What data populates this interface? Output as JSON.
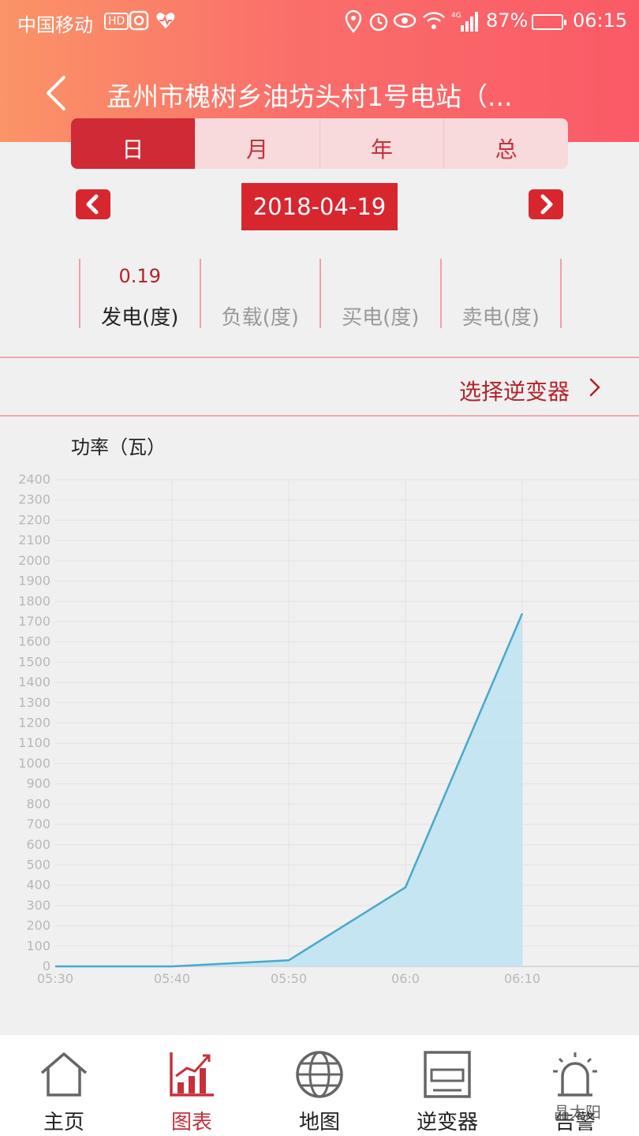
{
  "status_bar": {
    "carrier": "中国移动",
    "hd": "HD",
    "battery_percent": "87%",
    "time": "06:15"
  },
  "header": {
    "title": "孟州市槐树乡油坊头村1号电站（..."
  },
  "tabs": [
    {
      "label": "日",
      "active": true
    },
    {
      "label": "月",
      "active": false
    },
    {
      "label": "年",
      "active": false
    },
    {
      "label": "总",
      "active": false
    }
  ],
  "date_nav": {
    "date": "2018-04-19"
  },
  "stats": [
    {
      "value": "0.19",
      "label": "发电(度)",
      "active": true
    },
    {
      "value": "",
      "label": "负载(度)",
      "active": false
    },
    {
      "value": "",
      "label": "买电(度)",
      "active": false
    },
    {
      "value": "",
      "label": "卖电(度)",
      "active": false
    }
  ],
  "inverter_select": {
    "label": "选择逆变器"
  },
  "chart_data": {
    "type": "area",
    "ylabel": "功率（瓦）",
    "x": [
      "05:30",
      "05:40",
      "05:50",
      "06:0",
      "06:10"
    ],
    "values": [
      0,
      0,
      30,
      390,
      1740
    ],
    "ylim": [
      0,
      2400
    ],
    "ytick_step": 100,
    "grid": true,
    "fill_color": "#bfe3f1",
    "line_color": "#4aa8c8"
  },
  "bottom_nav": [
    {
      "label": "主页",
      "icon": "home-icon",
      "active": false
    },
    {
      "label": "图表",
      "icon": "chart-icon",
      "active": true
    },
    {
      "label": "地图",
      "icon": "globe-icon",
      "active": false
    },
    {
      "label": "逆变器",
      "icon": "inverter-icon",
      "active": false
    },
    {
      "label": "告警",
      "icon": "alarm-icon",
      "active": false
    }
  ],
  "watermark": "晶太阳",
  "colors": {
    "accent": "#d8262f",
    "header_start": "#fb9467",
    "header_end": "#fa5a66"
  }
}
